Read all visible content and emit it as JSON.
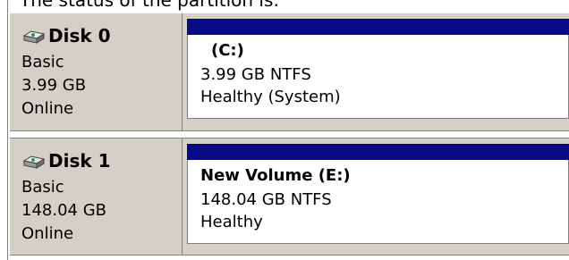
{
  "caption": "The status of the partition is:",
  "disks": [
    {
      "title": "Disk 0",
      "icon": "disk-drive-icon",
      "type": "Basic",
      "size": "3.99 GB",
      "status": "Online",
      "partition": {
        "label": "(C:)",
        "fs": "3.99 GB NTFS",
        "health": "Healthy (System)"
      }
    },
    {
      "title": "Disk 1",
      "icon": "disk-drive-icon",
      "type": "Basic",
      "size": "148.04 GB",
      "status": "Online",
      "partition": {
        "label": "New Volume  (E:)",
        "fs": "148.04 GB NTFS",
        "health": "Healthy"
      }
    }
  ],
  "colors": {
    "panel": "#d4d0c8",
    "partition_header": "#0a0a84",
    "border": "#808080"
  }
}
